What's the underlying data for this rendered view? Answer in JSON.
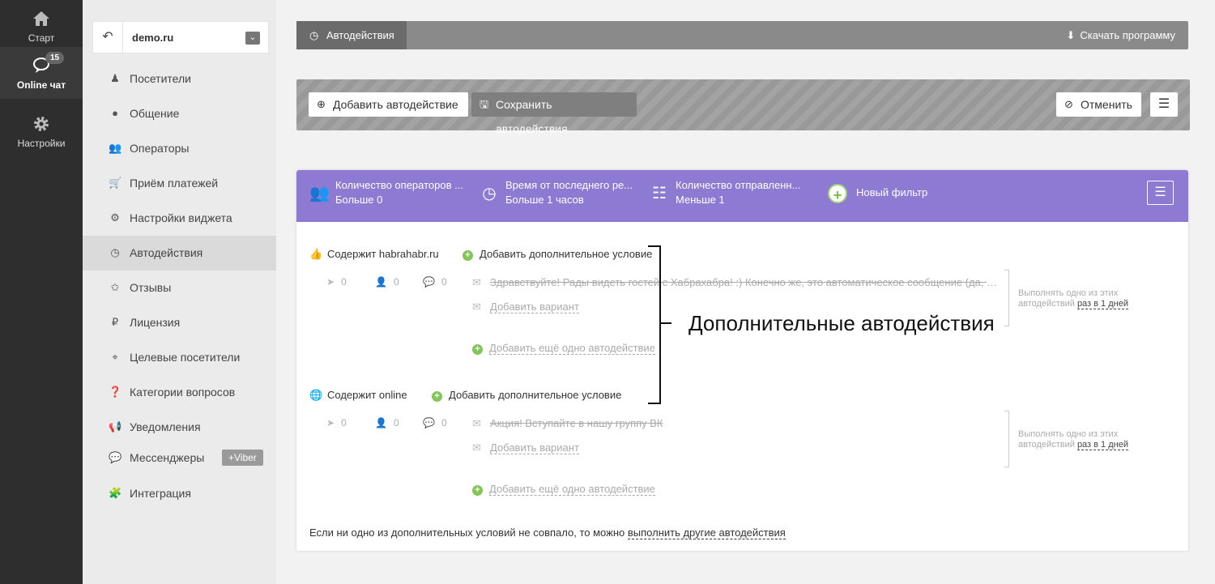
{
  "rail": {
    "start_label": "Старт",
    "chat_label": "Online чат",
    "chat_badge": "15",
    "settings_label": "Настройки"
  },
  "sidebar": {
    "site_name": "demo.ru",
    "items": [
      {
        "label": "Посетители",
        "icon": "person-icon"
      },
      {
        "label": "Общение",
        "icon": "comment-icon"
      },
      {
        "label": "Операторы",
        "icon": "users-icon"
      },
      {
        "label": "Приём платежей",
        "icon": "cart-icon"
      },
      {
        "label": "Настройки виджета",
        "icon": "gear-icon"
      },
      {
        "label": "Автодействия",
        "icon": "clock-icon"
      },
      {
        "label": "Отзывы",
        "icon": "star-icon"
      },
      {
        "label": "Лицензия",
        "icon": "ruble-icon"
      },
      {
        "label": "Целевые посетители",
        "icon": "crosshair-icon"
      },
      {
        "label": "Категории вопросов",
        "icon": "question-icon"
      },
      {
        "label": "Уведомления",
        "icon": "megaphone-icon"
      },
      {
        "label": "Мессенджеры",
        "icon": "chat-bubble-icon"
      },
      {
        "label": "Интеграция",
        "icon": "puzzle-icon"
      }
    ],
    "viber_badge": "+Viber"
  },
  "topbar": {
    "tab_label": "Автодействия",
    "download_label": "Скачать программу"
  },
  "toolbar": {
    "add_label": "Добавить автодействие",
    "save_label": "Сохранить автодействия",
    "cancel_label": "Отменить"
  },
  "filters": [
    {
      "line1": "Количество операторов ...",
      "line2": "Больше 0",
      "icon": "users-icon"
    },
    {
      "line1": "Время от последнего ре...",
      "line2": "Больше 1 часов",
      "icon": "clock-icon"
    },
    {
      "line1": "Количество отправленн...",
      "line2": "Меньше 1",
      "icon": "list-icon"
    }
  ],
  "new_filter_label": "Новый фильтр",
  "blocks": [
    {
      "condition": "Содержит habrahabr.ru",
      "add_condition": "Добавить дополнительное условие",
      "stats": [
        "0",
        "0",
        "0"
      ],
      "message": "Здравствуйте! Рады видеть гостей с Хабрахабра! :) Конечно же, это автоматическое сообщение (да, да...",
      "add_variant": "Добавить вариант",
      "add_more": "Добавить ещё одно автодействие",
      "freq_text": "Выполнять одно из этих автодействий",
      "freq_value": "раз в 1 дней"
    },
    {
      "condition": "Содержит online",
      "add_condition": "Добавить дополнительное условие",
      "stats": [
        "0",
        "0",
        "0"
      ],
      "message": "Акция! Вступайте в нашу группу ВК",
      "add_variant": "Добавить вариант",
      "add_more": "Добавить ещё одно автодействие",
      "freq_text": "Выполнять одно из этих автодействий",
      "freq_value": "раз в 1 дней"
    }
  ],
  "footer": {
    "text": "Если ни одно из дополнительных условий не совпало, то можно",
    "link": "выполнить другие автодействия"
  },
  "annotation": "Дополнительные автодействия",
  "colors": {
    "filter_bar": "#8e79d3",
    "plus_green": "#82c65a",
    "rail_bg": "#2e2e2e"
  }
}
